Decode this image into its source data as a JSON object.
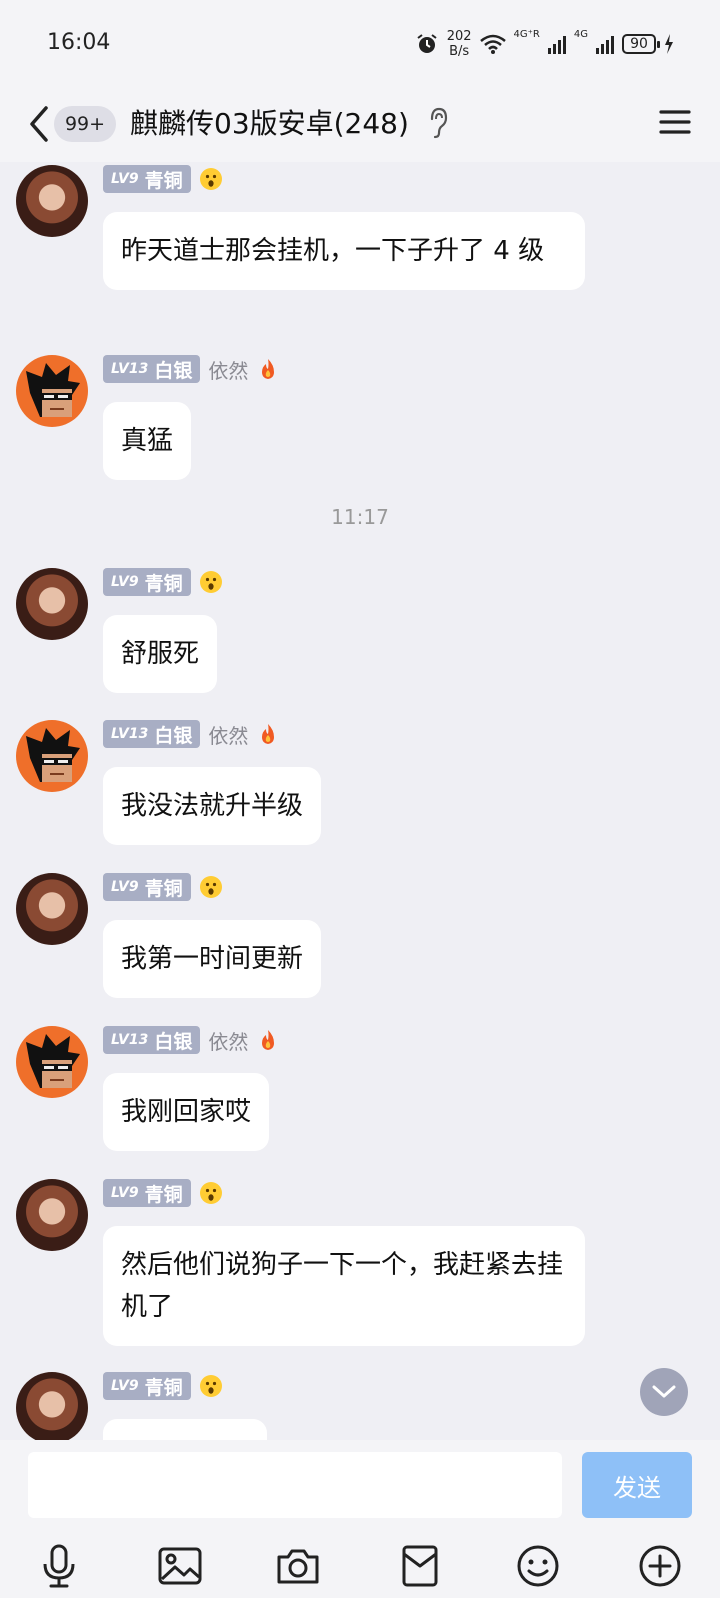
{
  "status_bar": {
    "time": "16:04",
    "net_speed_value": "202",
    "net_speed_unit": "B/s",
    "network_1": "4G⁺R",
    "network_2": "4G",
    "battery": "90"
  },
  "header": {
    "unread_count": "99+",
    "title": "麒麟传03版安卓(248)"
  },
  "messages": [
    {
      "level": "LV9",
      "rank": "青铜",
      "nickname": "",
      "text": "昨天道士那会挂机，一下子升了 4 级"
    },
    {
      "level": "LV13",
      "rank": "白银",
      "nickname": "依然",
      "text": "真猛"
    },
    {
      "level": "LV9",
      "rank": "青铜",
      "nickname": "",
      "text": "舒服死"
    },
    {
      "level": "LV13",
      "rank": "白银",
      "nickname": "依然",
      "text": "我没法就升半级"
    },
    {
      "level": "LV9",
      "rank": "青铜",
      "nickname": "",
      "text": "我第一时间更新"
    },
    {
      "level": "LV13",
      "rank": "白银",
      "nickname": "依然",
      "text": "我刚回家哎"
    },
    {
      "level": "LV9",
      "rank": "青铜",
      "nickname": "",
      "text": "然后他们说狗子一下一个，我赶紧去挂机了"
    },
    {
      "level": "LV9",
      "rank": "青铜",
      "nickname": "",
      "text": ""
    }
  ],
  "timestamp": "11:17",
  "composer": {
    "placeholder": "",
    "send_label": "发送"
  },
  "colors": {
    "background": "#efeff4",
    "badge": "#a8aec4",
    "send_button": "#8ec0f7"
  }
}
